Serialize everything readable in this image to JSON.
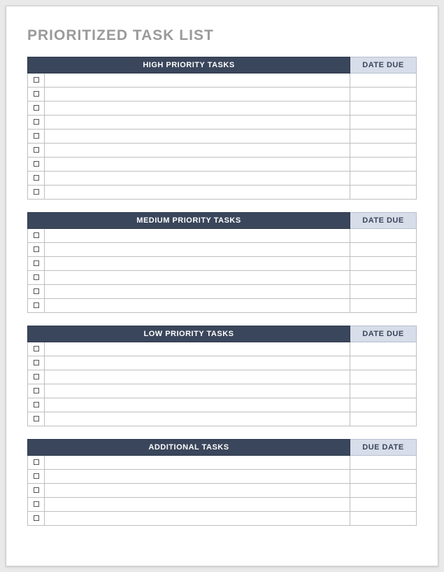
{
  "title": "PRIORITIZED TASK LIST",
  "sections": [
    {
      "task_header": "HIGH PRIORITY TASKS",
      "date_header": "DATE DUE",
      "rows": [
        {
          "checked": false,
          "task": "",
          "date": ""
        },
        {
          "checked": false,
          "task": "",
          "date": ""
        },
        {
          "checked": false,
          "task": "",
          "date": ""
        },
        {
          "checked": false,
          "task": "",
          "date": ""
        },
        {
          "checked": false,
          "task": "",
          "date": ""
        },
        {
          "checked": false,
          "task": "",
          "date": ""
        },
        {
          "checked": false,
          "task": "",
          "date": ""
        },
        {
          "checked": false,
          "task": "",
          "date": ""
        },
        {
          "checked": false,
          "task": "",
          "date": ""
        }
      ]
    },
    {
      "task_header": "MEDIUM PRIORITY TASKS",
      "date_header": "DATE DUE",
      "rows": [
        {
          "checked": false,
          "task": "",
          "date": ""
        },
        {
          "checked": false,
          "task": "",
          "date": ""
        },
        {
          "checked": false,
          "task": "",
          "date": ""
        },
        {
          "checked": false,
          "task": "",
          "date": ""
        },
        {
          "checked": false,
          "task": "",
          "date": ""
        },
        {
          "checked": false,
          "task": "",
          "date": ""
        }
      ]
    },
    {
      "task_header": "LOW PRIORITY TASKS",
      "date_header": "DATE DUE",
      "rows": [
        {
          "checked": false,
          "task": "",
          "date": ""
        },
        {
          "checked": false,
          "task": "",
          "date": ""
        },
        {
          "checked": false,
          "task": "",
          "date": ""
        },
        {
          "checked": false,
          "task": "",
          "date": ""
        },
        {
          "checked": false,
          "task": "",
          "date": ""
        },
        {
          "checked": false,
          "task": "",
          "date": ""
        }
      ]
    },
    {
      "task_header": "ADDITIONAL TASKS",
      "date_header": "DUE DATE",
      "rows": [
        {
          "checked": false,
          "task": "",
          "date": ""
        },
        {
          "checked": false,
          "task": "",
          "date": ""
        },
        {
          "checked": false,
          "task": "",
          "date": ""
        },
        {
          "checked": false,
          "task": "",
          "date": ""
        },
        {
          "checked": false,
          "task": "",
          "date": ""
        }
      ]
    }
  ]
}
